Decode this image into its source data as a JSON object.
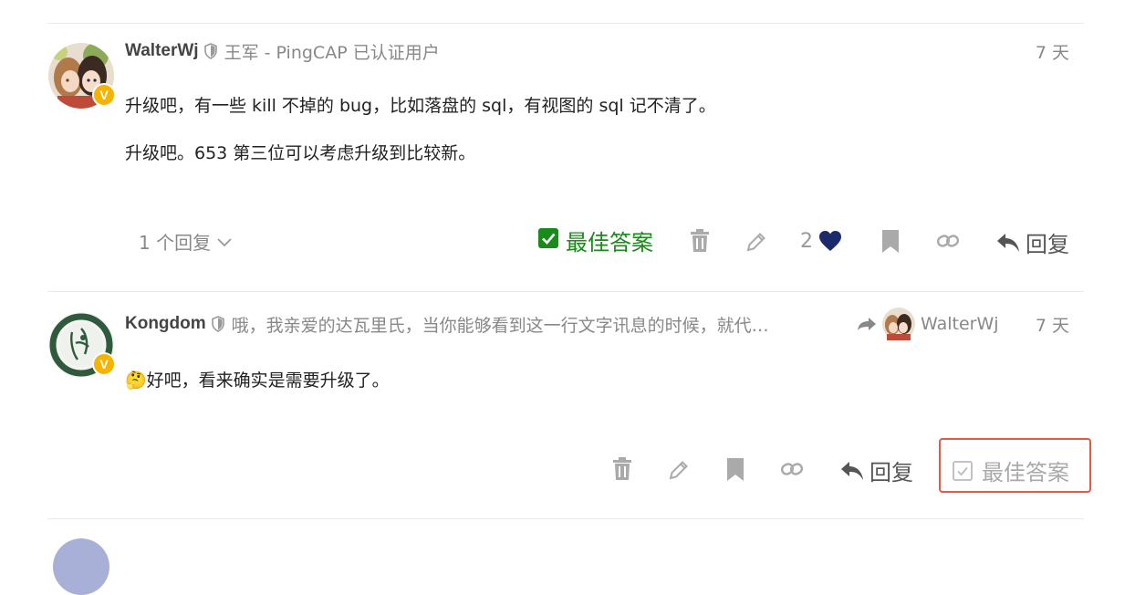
{
  "posts": [
    {
      "username": "WalterWj",
      "user_title": "王军 - PingCAP 已认证用户",
      "date": "7 天",
      "paragraphs": [
        "升级吧，有一些 kill 不掉的 bug，比如落盘的 sql，有视图的 sql 记不清了。",
        "升级吧。653 第三位可以考虑升级到比较新。"
      ],
      "replies_label": "1 个回复",
      "solution_label": "最佳答案",
      "like_count": "2",
      "reply_label": "回复"
    },
    {
      "username": "Kongdom",
      "user_title": "哦，我亲爱的达瓦里氏，当你能够看到这一行文字讯息的时候，就代…",
      "reply_to": "WalterWj",
      "date": "7 天",
      "emoji": "🤔",
      "paragraph": "好吧，看来确实是需要升级了。",
      "reply_label": "回复",
      "solution_label": "最佳答案"
    }
  ],
  "colors": {
    "solved_green": "#1a8a1a",
    "like_heart": "#1b2a6b",
    "verified_badge": "#f6b400",
    "highlight_outline": "#e05a4a"
  }
}
